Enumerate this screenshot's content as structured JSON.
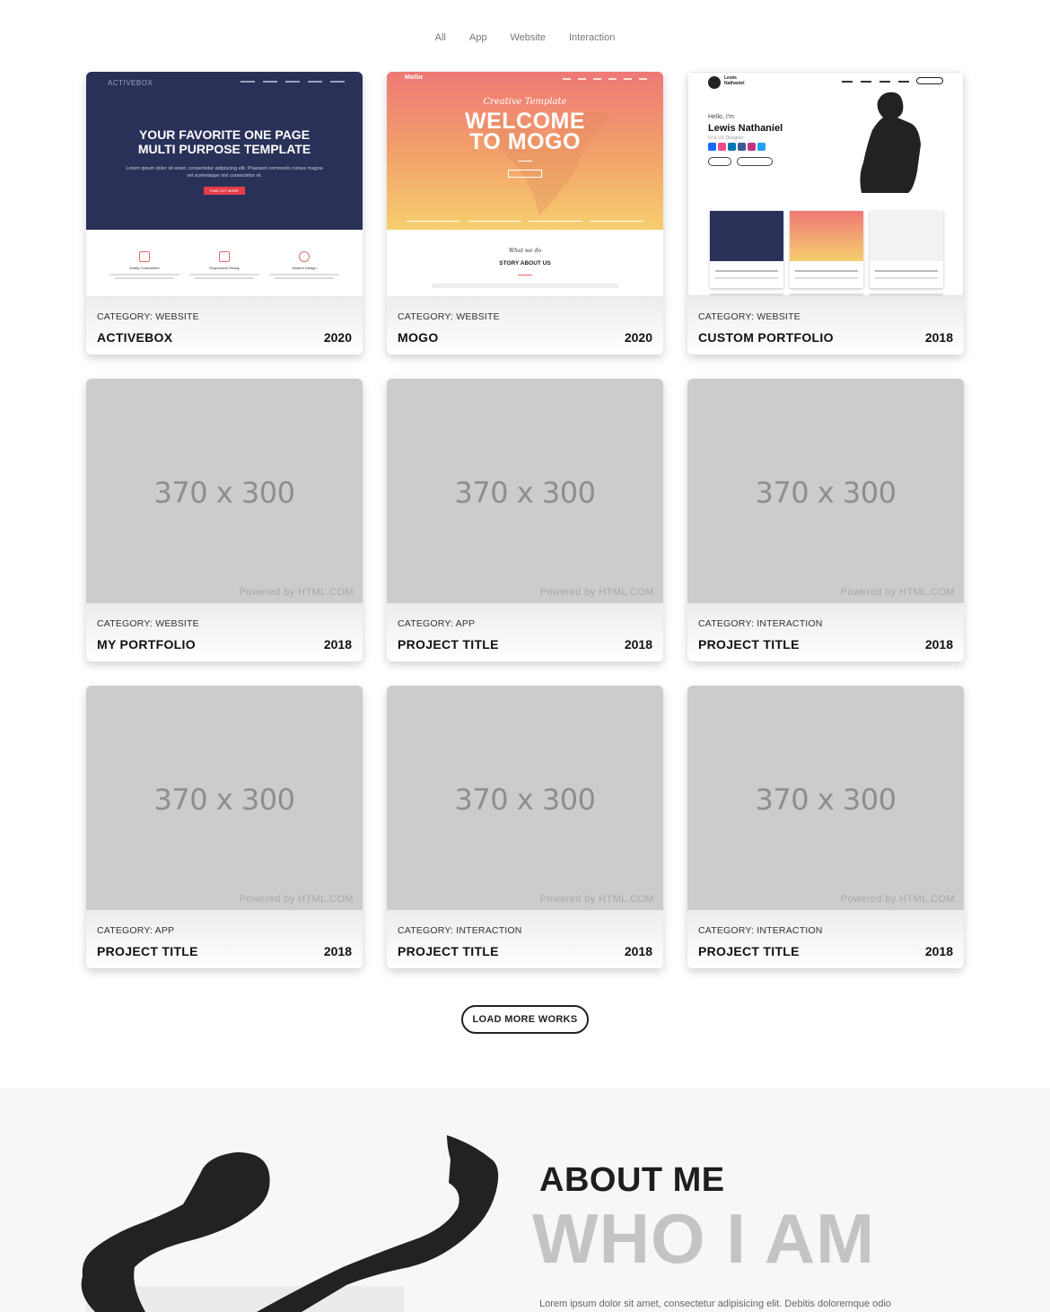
{
  "filters": [
    "All",
    "App",
    "Website",
    "Interaction"
  ],
  "works": [
    {
      "category": "CATEGORY: WEBSITE",
      "title": "ACTIVEBOX",
      "year": "2020",
      "thumb": "activebox"
    },
    {
      "category": "CATEGORY: WEBSITE",
      "title": "MOGO",
      "year": "2020",
      "thumb": "mogo"
    },
    {
      "category": "CATEGORY: WEBSITE",
      "title": "CUSTOM PORTFOLIO",
      "year": "2018",
      "thumb": "portfolio"
    },
    {
      "category": "CATEGORY: WEBSITE",
      "title": "MY PORTFOLIO",
      "year": "2018",
      "thumb": "placeholder"
    },
    {
      "category": "CATEGORY: APP",
      "title": "PROJECT TITLE",
      "year": "2018",
      "thumb": "placeholder"
    },
    {
      "category": "CATEGORY: INTERACTION",
      "title": "PROJECT TITLE",
      "year": "2018",
      "thumb": "placeholder"
    },
    {
      "category": "CATEGORY: APP",
      "title": "PROJECT TITLE",
      "year": "2018",
      "thumb": "placeholder"
    },
    {
      "category": "CATEGORY: INTERACTION",
      "title": "PROJECT TITLE",
      "year": "2018",
      "thumb": "placeholder"
    },
    {
      "category": "CATEGORY: INTERACTION",
      "title": "PROJECT TITLE",
      "year": "2018",
      "thumb": "placeholder"
    }
  ],
  "placeholder": {
    "size_text": "370 x 300",
    "powered_text": "Powered by HTML.COM"
  },
  "activebox_thumb": {
    "logo": "ACTIVEBOX",
    "headline_1": "YOUR FAVORITE ONE PAGE",
    "headline_2": "MULTI PURPOSE TEMPLATE",
    "lead": "Lorem ipsum dolor sit amet, consectetur adipiscing elit. Praesent commodo cursus magna vel scelerisque nisl consectetur et.",
    "button": "FIND OUT MORE",
    "features": [
      "Easily Customised",
      "Responsive Ready",
      "Modern Design"
    ]
  },
  "mogo_thumb": {
    "logo": "MoGo",
    "script": "Creative Template",
    "headline_1": "WELCOME",
    "headline_2": "TO MOGO",
    "bottom_script": "What we do",
    "bottom_title": "STORY ABOUT US"
  },
  "portfolio_thumb": {
    "small_name": "Lewis Nathaniel",
    "hello": "Hello, I'm",
    "name": "Lewis Nathaniel",
    "role": "UI & UX Designer"
  },
  "load_more": "LOAD MORE WORKS",
  "about": {
    "title": "ABOUT ME",
    "subtitle": "WHO I AM",
    "text": "Lorem ipsum dolor sit amet, consectetur adipisicing elit. Debitis doloremque odio"
  },
  "colors": {
    "activebox_bg": "#2a3159",
    "activebox_accent": "#e53e4a",
    "mogo_gradient_top": "#ee7876",
    "mogo_gradient_bottom": "#f7cf6f",
    "placeholder_bg": "#cccccc",
    "about_bg": "#f7f7f7"
  }
}
